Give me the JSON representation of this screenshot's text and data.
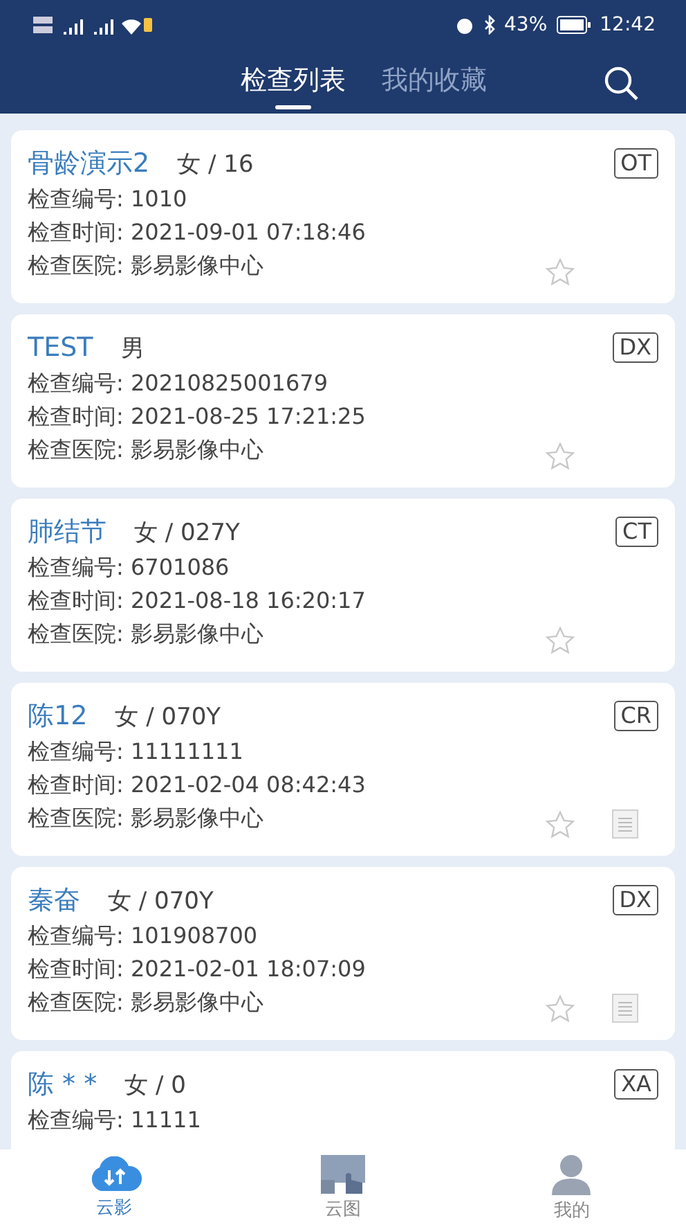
{
  "status_bar": {
    "battery": "43%",
    "time": "12:42"
  },
  "header": {
    "tabs": [
      {
        "label": "检查列表",
        "selected": true
      },
      {
        "label": "我的收藏",
        "selected": false
      }
    ]
  },
  "exams": [
    {
      "name": "骨龄演示2",
      "patient": "女 / 16",
      "modality": "OT",
      "lines": [
        "检查编号: 1010",
        "检查时间: 2021-09-01 07:18:46",
        "检查医院: 影易影像中心"
      ],
      "favorite": false,
      "report": false
    },
    {
      "name": "TEST",
      "patient": "男",
      "modality": "DX",
      "lines": [
        "检查编号: 20210825001679",
        "检查时间: 2021-08-25 17:21:25",
        "检查医院: 影易影像中心"
      ],
      "favorite": false,
      "report": false
    },
    {
      "name": "肺结节",
      "patient": "女 / 027Y",
      "modality": "CT",
      "lines": [
        "检查编号: 6701086",
        "检查时间: 2021-08-18 16:20:17",
        "检查医院: 影易影像中心"
      ],
      "favorite": false,
      "report": false
    },
    {
      "name": "陈12",
      "patient": "女 / 070Y",
      "modality": "CR",
      "lines": [
        "检查编号: 11111111",
        "检查时间: 2021-02-04 08:42:43",
        "检查医院: 影易影像中心"
      ],
      "favorite": false,
      "report": true
    },
    {
      "name": "秦奋",
      "patient": "女 / 070Y",
      "modality": "DX",
      "lines": [
        "检查编号: 101908700",
        "检查时间: 2021-02-01 18:07:09",
        "检查医院: 影易影像中心"
      ],
      "favorite": false,
      "report": true
    },
    {
      "name": "陈 * *",
      "patient": "女 / 0",
      "modality": "XA",
      "lines": [
        "检查编号: 11111"
      ]
    }
  ],
  "bottom_nav": [
    {
      "label": "云影",
      "kind": "cloud",
      "selected": true
    },
    {
      "label": "云图",
      "kind": "gallery",
      "selected": false
    },
    {
      "label": "我的",
      "kind": "profile",
      "selected": false
    }
  ]
}
